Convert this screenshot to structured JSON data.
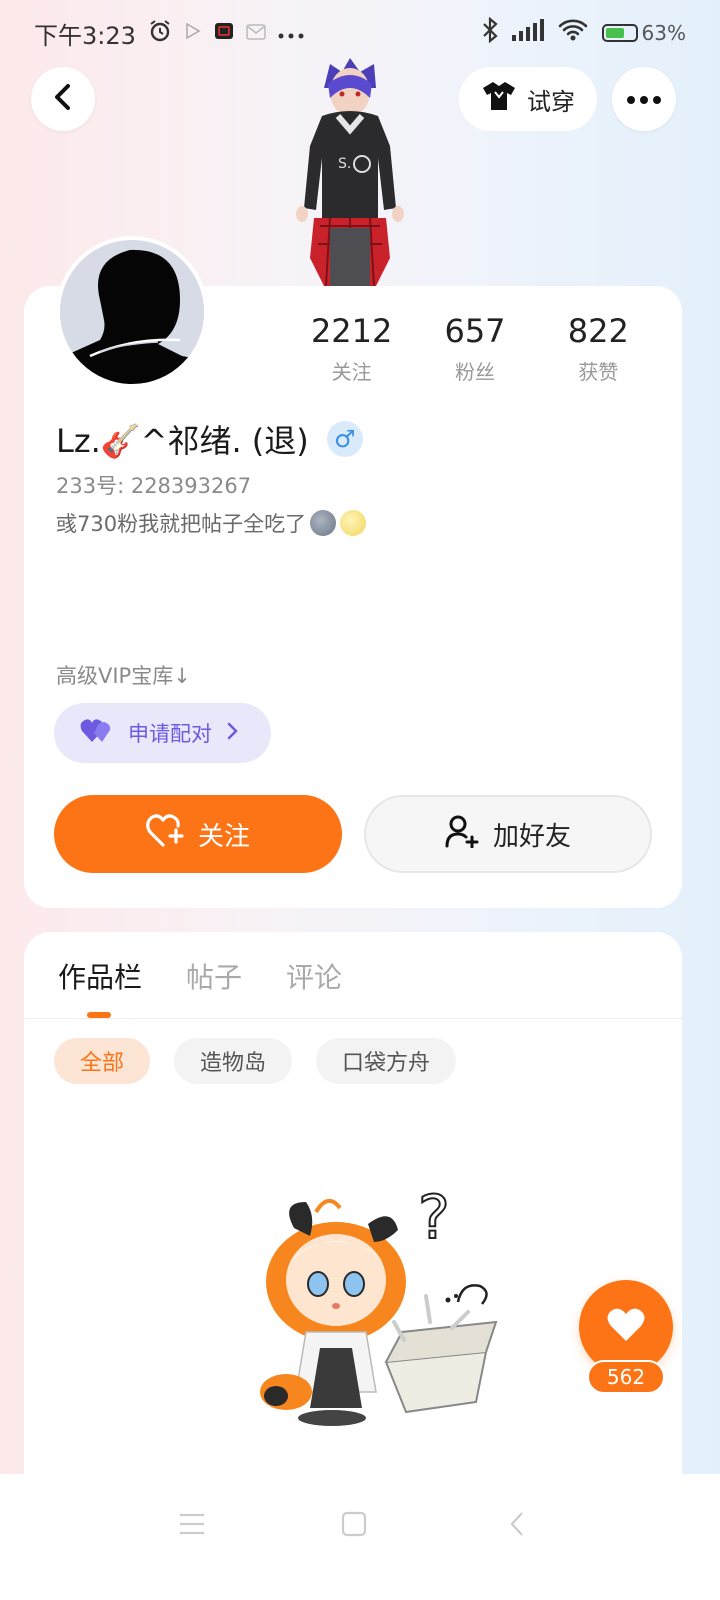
{
  "status_bar": {
    "time": "下午3:23",
    "battery": "63%",
    "battery_level": 0.63,
    "icons": [
      "alarm-icon",
      "play-store-icon",
      "app-notification-icon",
      "mail-icon",
      "more-dots-icon",
      "bluetooth-icon",
      "signal-icon",
      "wifi-icon",
      "battery-icon"
    ]
  },
  "header": {
    "try_on_label": "试穿"
  },
  "profile": {
    "username": "Lz.🎸^祁绪. (退)",
    "gender_symbol": "♂",
    "user_id": "233号: 228393267",
    "bio": "彧730粉我就把帖子全吃了",
    "vip_link": "高级VIP宝库↓",
    "pair_label": "申请配对",
    "stats": [
      {
        "value": "2212",
        "label": "关注"
      },
      {
        "value": "657",
        "label": "粉丝"
      },
      {
        "value": "822",
        "label": "获赞"
      }
    ],
    "follow_label": "关注",
    "add_friend_label": "加好友"
  },
  "content": {
    "tabs": [
      {
        "label": "作品栏",
        "active": true
      },
      {
        "label": "帖子",
        "active": false
      },
      {
        "label": "评论",
        "active": false
      }
    ],
    "filters": [
      {
        "label": "全部",
        "active": true
      },
      {
        "label": "造物岛",
        "active": false
      },
      {
        "label": "口袋方舟",
        "active": false
      }
    ]
  },
  "floating_like": {
    "count": "562"
  },
  "colors": {
    "accent": "#fc7415",
    "pair_purple": "#6a5be0",
    "gender_blue": "#3d8fe0"
  }
}
